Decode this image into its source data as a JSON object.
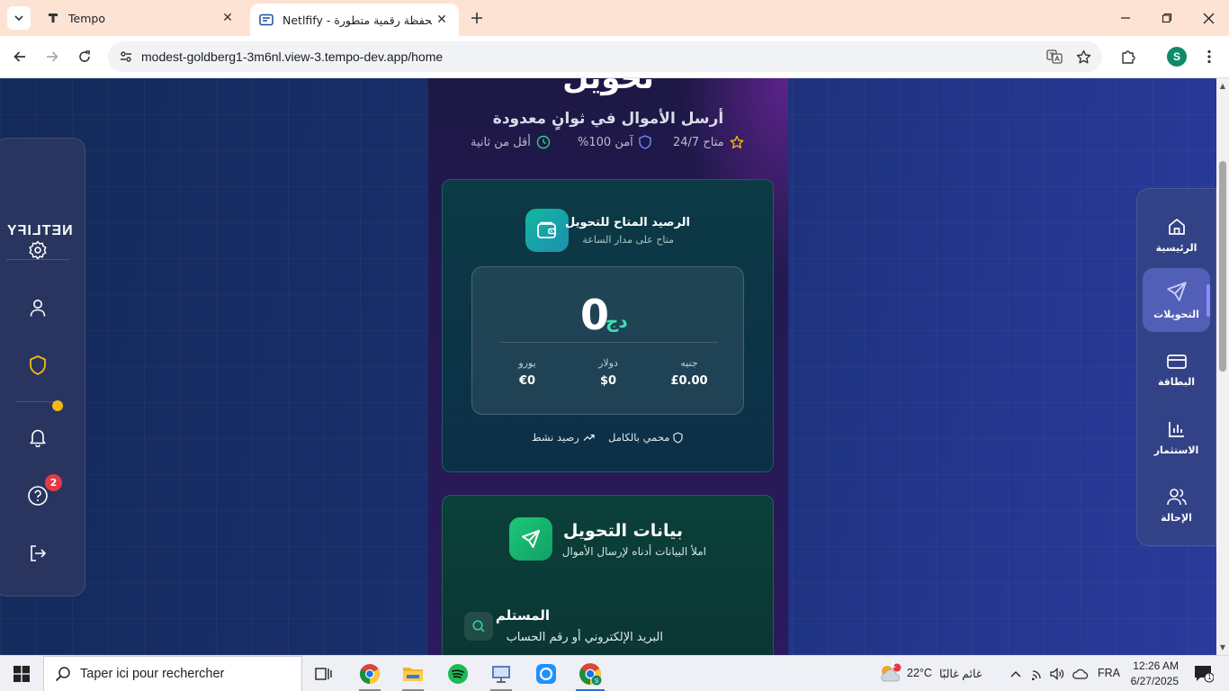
{
  "browser": {
    "tabs": [
      {
        "label": "Tempo",
        "icon": "tempo-icon"
      },
      {
        "label": "Netlfify - محفظة رقمية متطورة",
        "icon": "page-icon"
      }
    ],
    "close_glyph": "✕",
    "url": "modest-goldberg1-3m6nl.view-3.tempo-dev.app/home",
    "profile_initial": "S"
  },
  "hero": {
    "title": "تحويل",
    "subtitle": "أرسل الأموال في ثوانٍ معدودة",
    "features": [
      {
        "label": "متاح 24/7",
        "icon": "star-icon"
      },
      {
        "label": "آمن 100%",
        "icon": "shield-icon"
      },
      {
        "label": "أقل من ثانية",
        "icon": "clock-icon"
      }
    ]
  },
  "balance_card": {
    "title": "الرصيد المتاح للتحويل",
    "subtitle": "متاح على مدار الساعة",
    "amount": "0",
    "currency": "دج",
    "conversions": [
      {
        "name": "جنيه",
        "value": "£0.00"
      },
      {
        "name": "دولار",
        "value": "$0"
      },
      {
        "name": "يورو",
        "value": "€0"
      }
    ],
    "footer": [
      {
        "label": "محمي بالكامل",
        "icon": "shield-icon"
      },
      {
        "label": "رصيد نشط",
        "icon": "trending-up-icon"
      }
    ]
  },
  "transfer_card": {
    "title": "بيانات التحويل",
    "subtitle": "املأ البيانات أدناه لإرسال الأموال",
    "recipient_label": "المستلم",
    "recipient_hint": "البريد الإلكتروني أو رقم الحساب"
  },
  "left_sidebar": {
    "logo": "NETLIFY",
    "notifications_count": "2",
    "items": [
      "settings",
      "profile",
      "security",
      "notifications",
      "help",
      "logout"
    ]
  },
  "right_nav": {
    "items": [
      {
        "label": "الرئيسية",
        "icon": "home-icon",
        "active": false
      },
      {
        "label": "التحويلات",
        "icon": "send-icon",
        "active": true
      },
      {
        "label": "البطاقة",
        "icon": "card-icon",
        "active": false
      },
      {
        "label": "الاستثمار",
        "icon": "chart-icon",
        "active": false
      },
      {
        "label": "الإحالة",
        "icon": "users-icon",
        "active": false
      }
    ]
  },
  "taskbar": {
    "search_placeholder": "Taper ici pour rechercher",
    "weather_temp": "22°C",
    "weather_desc": "غائم غالبًا",
    "weather_badge": "1",
    "language": "FRA",
    "time": "12:26 AM",
    "date": "6/27/2025",
    "notification_badge": "1"
  },
  "colors": {
    "accent_green": "#3fe0b0",
    "active_nav": "#6e78dc",
    "badge_red": "#e23a48",
    "badge_yellow": "#f5b814"
  }
}
